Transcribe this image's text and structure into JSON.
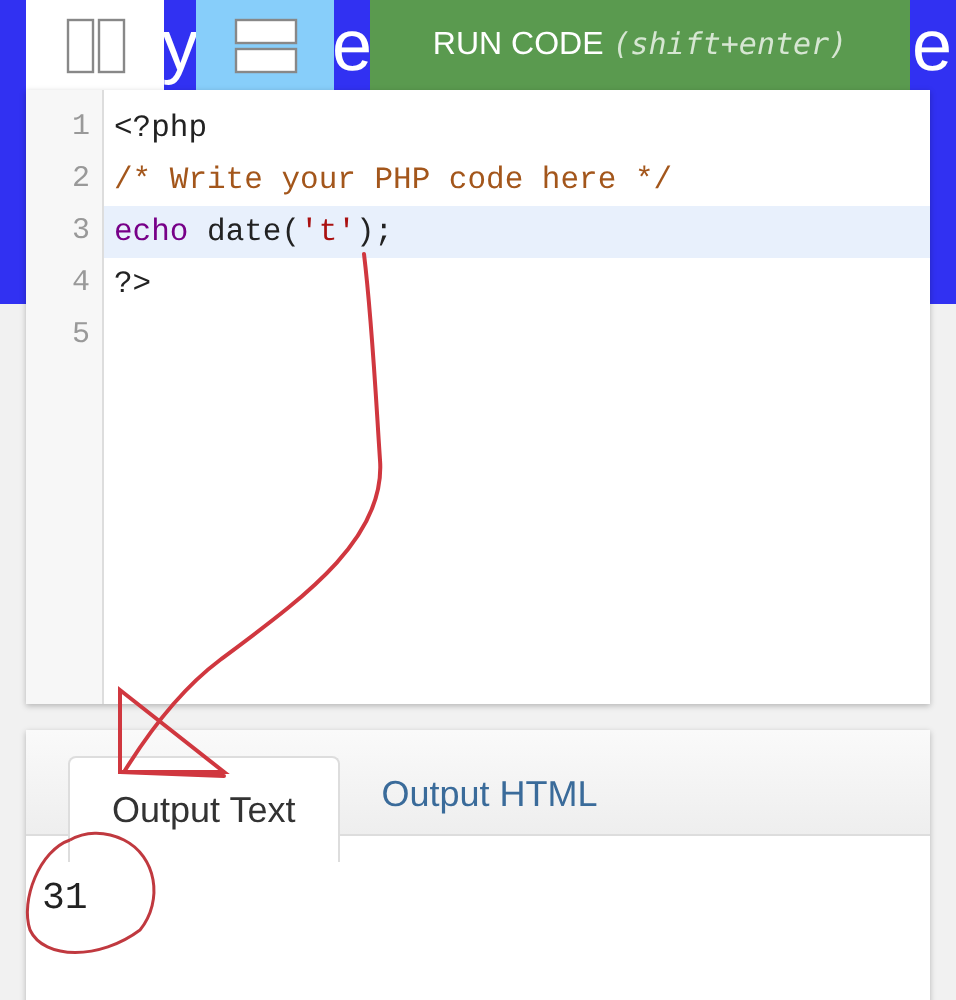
{
  "toolbar": {
    "items": [
      {
        "kind": "columns_layout",
        "selected": false
      },
      {
        "kind": "fragment",
        "text": "y"
      },
      {
        "kind": "rows_layout",
        "selected": true
      },
      {
        "kind": "fragment",
        "text": "e"
      },
      {
        "kind": "run",
        "label": "RUN CODE",
        "hint": "(shift+enter)"
      },
      {
        "kind": "fragment",
        "text": "e"
      }
    ]
  },
  "editor": {
    "lines": [
      {
        "number": "1",
        "active": false,
        "tokens": [
          {
            "kind": "plain",
            "text": "<?php"
          }
        ]
      },
      {
        "number": "2",
        "active": false,
        "tokens": [
          {
            "kind": "comment",
            "text": "/* Write your PHP code here */"
          }
        ]
      },
      {
        "number": "3",
        "active": true,
        "tokens": [
          {
            "kind": "keyword",
            "text": "echo"
          },
          {
            "kind": "plain",
            "text": " date("
          },
          {
            "kind": "string",
            "text": "'t'"
          },
          {
            "kind": "plain",
            "text": ");"
          }
        ]
      },
      {
        "number": "4",
        "active": false,
        "tokens": [
          {
            "kind": "plain",
            "text": "?>"
          }
        ]
      },
      {
        "number": "5",
        "active": false
      }
    ]
  },
  "output": {
    "tabs": [
      {
        "label": "Output Text",
        "selected": true
      },
      {
        "label": "Output HTML",
        "selected": false
      }
    ],
    "text": "31"
  }
}
